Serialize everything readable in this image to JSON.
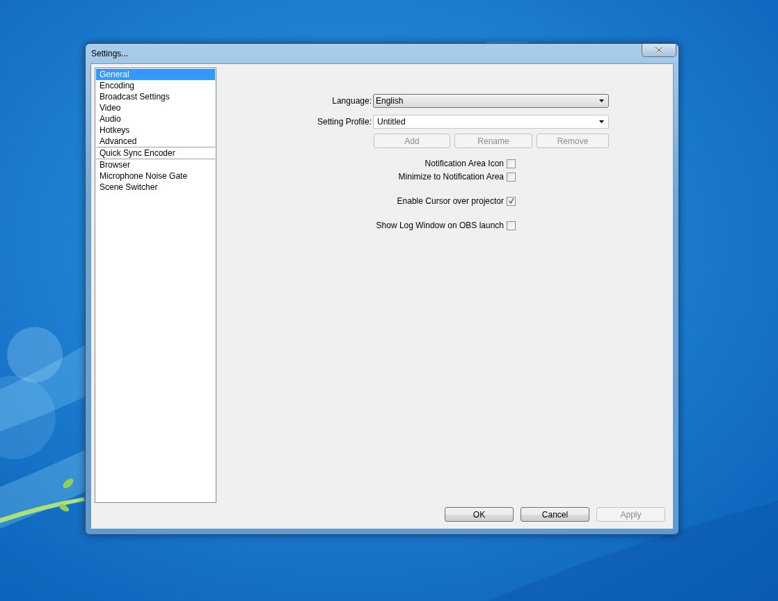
{
  "window": {
    "title": "Settings..."
  },
  "sidebar": {
    "groups": [
      [
        {
          "label": "General",
          "selected": true
        },
        {
          "label": "Encoding",
          "selected": false
        },
        {
          "label": "Broadcast Settings",
          "selected": false
        },
        {
          "label": "Video",
          "selected": false
        },
        {
          "label": "Audio",
          "selected": false
        },
        {
          "label": "Hotkeys",
          "selected": false
        },
        {
          "label": "Advanced",
          "selected": false
        }
      ],
      [
        {
          "label": "Quick Sync Encoder",
          "selected": false
        }
      ],
      [
        {
          "label": "Browser",
          "selected": false
        },
        {
          "label": "Microphone Noise Gate",
          "selected": false
        },
        {
          "label": "Scene Switcher",
          "selected": false
        }
      ]
    ]
  },
  "language": {
    "label": "Language:",
    "value": "English"
  },
  "profile": {
    "label": "Setting Profile:",
    "value": "Untitled",
    "buttons": [
      {
        "label": "Add",
        "disabled": true
      },
      {
        "label": "Rename",
        "disabled": true
      },
      {
        "label": "Remove",
        "disabled": true
      }
    ]
  },
  "checkbox_groups": [
    [
      {
        "label": "Notification Area Icon",
        "checked": false
      },
      {
        "label": "Minimize to Notification Area",
        "checked": false
      }
    ],
    [
      {
        "label": "Enable Cursor over projector",
        "checked": true
      }
    ],
    [
      {
        "label": "Show Log Window on OBS launch",
        "checked": false
      }
    ]
  ],
  "buttons": [
    {
      "label": "OK",
      "disabled": false
    },
    {
      "label": "Cancel",
      "disabled": false
    },
    {
      "label": "Apply",
      "disabled": true
    }
  ]
}
